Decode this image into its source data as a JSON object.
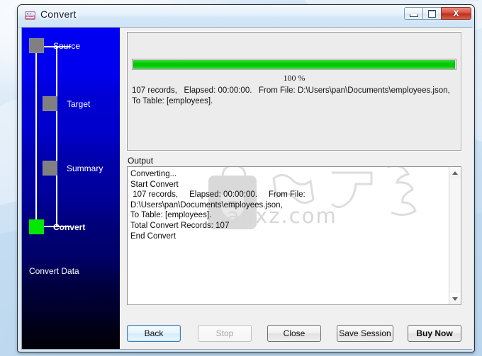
{
  "window": {
    "title": "Convert",
    "icon": "convert-app-icon",
    "controls": {
      "minimize": "minimize-icon",
      "maximize": "maximize-icon",
      "close": "X"
    }
  },
  "sidebar": {
    "steps": [
      {
        "label": "Source",
        "state": "pending",
        "marker_color": "#808080"
      },
      {
        "label": "Target",
        "state": "pending",
        "marker_color": "#808080"
      },
      {
        "label": "Summary",
        "state": "pending",
        "marker_color": "#808080"
      },
      {
        "label": "Convert",
        "state": "active",
        "marker_color": "#00e800"
      }
    ],
    "section_label": "Convert Data"
  },
  "main": {
    "progress": {
      "percent": 100,
      "percent_label": "100 %",
      "bar_color": "#00c700"
    },
    "status_text": "107 records,   Elapsed: 00:00:00.   From File: D:\\Users\\pan\\Documents\\employees.json,   To Table: [employees].",
    "output_label": "Output",
    "output_lines": [
      "Converting...",
      "Start Convert",
      " 107 records,     Elapsed: 00:00:00.     From File: D:\\Users\\pan\\Documents\\employees.json,",
      "To Table: [employees].",
      "Total Convert Records: 107",
      "End Convert"
    ],
    "watermark_text": "anxz.com",
    "scrollbar": {
      "up_arrow": "scroll-up-icon",
      "down_arrow": "scroll-down-icon"
    }
  },
  "buttons": {
    "back": "Back",
    "stop": "Stop",
    "close": "Close",
    "save_session": "Save Session",
    "buy_now": "Buy Now"
  }
}
